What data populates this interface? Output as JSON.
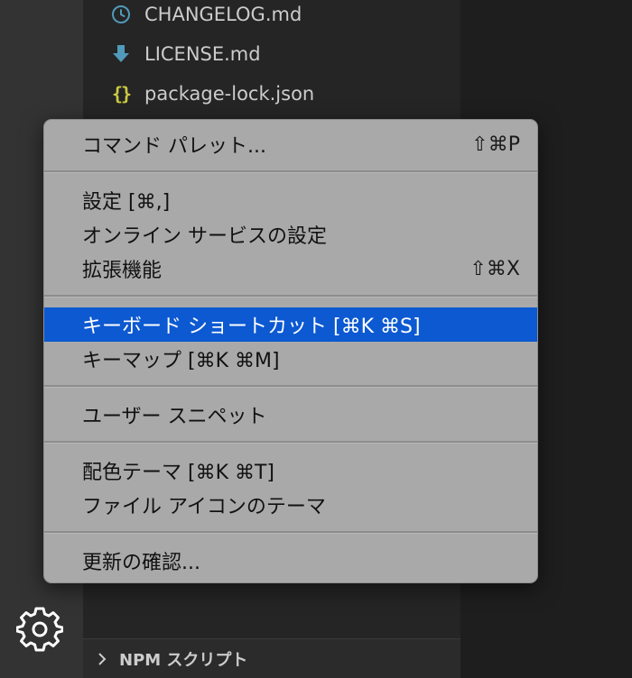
{
  "explorer": {
    "files": [
      {
        "name": "CHANGELOG.md",
        "icon": "clock-icon",
        "color": "#519aba"
      },
      {
        "name": "LICENSE.md",
        "icon": "download-arrow-icon",
        "color": "#519aba"
      },
      {
        "name": "package-lock.json",
        "icon": "braces-icon",
        "color": "#cbcb41",
        "glyph": "{}"
      }
    ],
    "npm_section_label": "NPM スクリプト"
  },
  "menu": {
    "highlight_color": "#0c59d1",
    "items": [
      {
        "label": "コマンド パレット...",
        "shortcut": "⇧⌘P"
      },
      {
        "label": "設定 [⌘,]",
        "shortcut": ""
      },
      {
        "label": "オンライン サービスの設定",
        "shortcut": ""
      },
      {
        "label": "拡張機能",
        "shortcut": "⇧⌘X"
      },
      {
        "label": "キーボード ショートカット [⌘K ⌘S]",
        "shortcut": "",
        "highlighted": true
      },
      {
        "label": "キーマップ [⌘K ⌘M]",
        "shortcut": ""
      },
      {
        "label": "ユーザー スニペット",
        "shortcut": ""
      },
      {
        "label": "配色テーマ [⌘K ⌘T]",
        "shortcut": ""
      },
      {
        "label": "ファイル アイコンのテーマ",
        "shortcut": ""
      },
      {
        "label": "更新の確認...",
        "shortcut": ""
      }
    ]
  },
  "activity_bar": {
    "manage_icon": "gear-icon"
  }
}
